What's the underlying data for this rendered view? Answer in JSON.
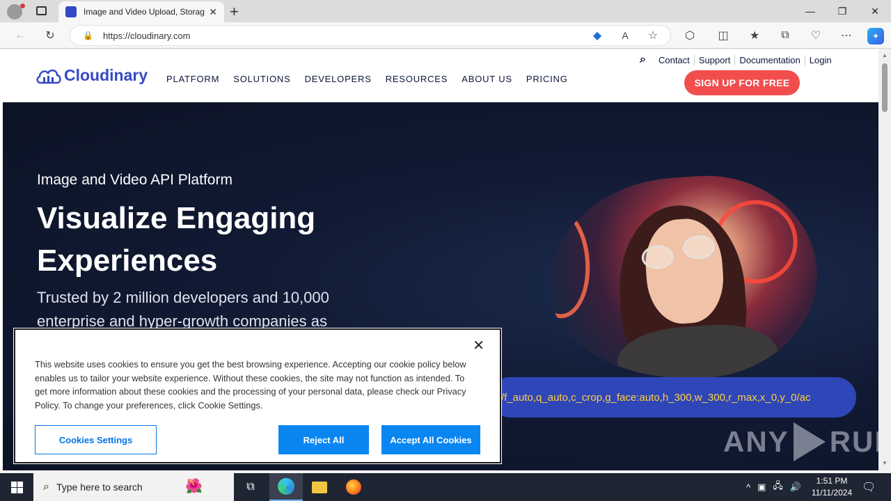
{
  "browser": {
    "tab_title": "Image and Video Upload, Storag",
    "tab_close": "✕",
    "new_tab": "+",
    "url": "https://cloudinary.com"
  },
  "site": {
    "logo_text": "Cloudinary",
    "nav": [
      "PLATFORM",
      "SOLUTIONS",
      "DEVELOPERS",
      "RESOURCES",
      "ABOUT US",
      "PRICING"
    ],
    "top_links": [
      "Contact",
      "Support",
      "Documentation",
      "Login"
    ],
    "signup_label": "SIGN UP FOR FREE",
    "accent_color": "#3448c5",
    "signup_color": "#f24d4d"
  },
  "hero": {
    "subtitle": "Image and Video API Platform",
    "title": "Visualize Engaging Experiences",
    "description": "Trusted by 2 million developers and 10,000 enterprise and hyper-growth companies as",
    "transform_url": "/f_auto,q_auto,c_crop,g_face:auto,h_300,w_300,r_max,x_0,y_0/ac"
  },
  "cookie_dialog": {
    "text": "This website uses cookies to ensure you get the best browsing experience. Accepting our cookie policy below enables us to tailor your website experience. Without these cookies, the site may not function as intended. To get more information about these cookies and the processing of your personal data, please check our Privacy Policy. To change your preferences, click Cookie Settings.",
    "settings_label": "Cookies Settings",
    "reject_label": "Reject All",
    "accept_label": "Accept All Cookies",
    "close_label": "✕"
  },
  "watermark": {
    "left": "ANY",
    "right": "RUN"
  },
  "taskbar": {
    "search_placeholder": "Type here to search",
    "time": "1:51 PM",
    "date": "11/11/2024"
  }
}
